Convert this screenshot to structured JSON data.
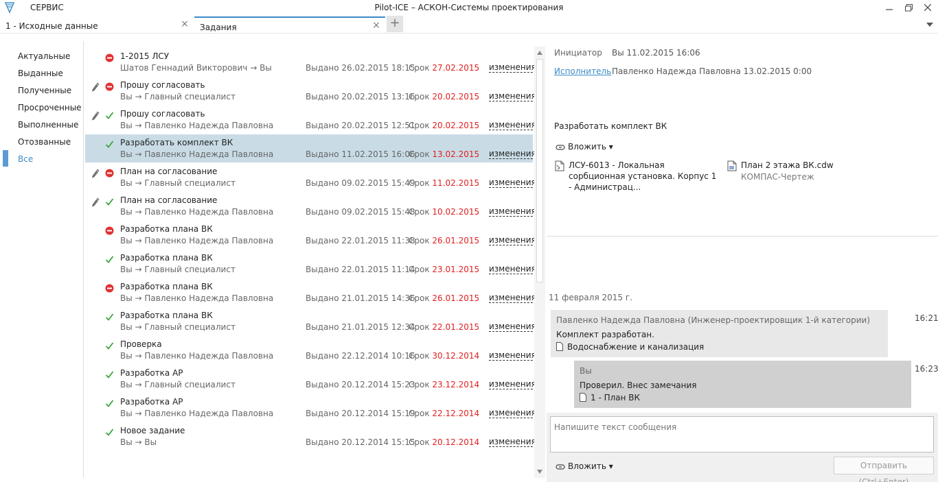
{
  "window": {
    "title": "Pilot-ICE – АСКОН-Системы проектирования",
    "menu_service": "СЕРВИС"
  },
  "tabs": [
    {
      "label": "1 - Исходные данные"
    },
    {
      "label": "Задания"
    }
  ],
  "nav": {
    "items": [
      "Актуальные",
      "Выданные",
      "Полученные",
      "Просроченные",
      "Выполненные",
      "Отозванные",
      "Все"
    ],
    "active_index": 6
  },
  "due_prefix": "Срок",
  "changes_label": "изменения",
  "tasks": [
    {
      "title": "1-2015 ЛСУ",
      "route": "Шатов Геннадий Викторович → Вы",
      "issued": "Выдано 26.02.2015 18:15",
      "due": "27.02.2015",
      "status": "blocked",
      "pen": false,
      "selected": false
    },
    {
      "title": "Прошу согласовать",
      "route": "Вы → Главный специалист",
      "issued": "Выдано 20.02.2015 13:16",
      "due": "20.02.2015",
      "status": "blocked",
      "pen": true,
      "selected": false
    },
    {
      "title": "Прошу согласовать",
      "route": "Вы → Павленко Надежда Павловна",
      "issued": "Выдано 20.02.2015 12:51",
      "due": "20.02.2015",
      "status": "done",
      "pen": true,
      "selected": false
    },
    {
      "title": "Разработать комплект ВК",
      "route": "Вы → Павленко Надежда Павловна",
      "issued": "Выдано 11.02.2015 16:06",
      "due": "13.02.2015",
      "status": "done",
      "pen": false,
      "selected": true
    },
    {
      "title": "План на согласование",
      "route": "Вы → Главный специалист",
      "issued": "Выдано 09.02.2015 15:49",
      "due": "11.02.2015",
      "status": "blocked",
      "pen": true,
      "selected": false
    },
    {
      "title": "План на согласование",
      "route": "Вы → Павленко Надежда Павловна",
      "issued": "Выдано 09.02.2015 15:48",
      "due": "10.02.2015",
      "status": "done",
      "pen": true,
      "selected": false
    },
    {
      "title": "Разработка плана ВК",
      "route": "Вы → Павленко Надежда Павловна",
      "issued": "Выдано 22.01.2015 11:38",
      "due": "26.01.2015",
      "status": "blocked",
      "pen": false,
      "selected": false
    },
    {
      "title": "Разработка плана ВК",
      "route": "Вы → Главный специалист",
      "issued": "Выдано 22.01.2015 11:14",
      "due": "23.01.2015",
      "status": "done",
      "pen": false,
      "selected": false
    },
    {
      "title": "Разработка плана ВК",
      "route": "Вы → Павленко Надежда Павловна",
      "issued": "Выдано 21.01.2015 14:36",
      "due": "26.01.2015",
      "status": "blocked",
      "pen": false,
      "selected": false
    },
    {
      "title": "Разработка плана ВК",
      "route": "Вы → Главный специалист",
      "issued": "Выдано 21.01.2015 12:34",
      "due": "22.01.2015",
      "status": "done",
      "pen": false,
      "selected": false
    },
    {
      "title": "Проверка",
      "route": "Вы → Павленко Надежда Павловна",
      "issued": "Выдано 22.12.2014 10:16",
      "due": "30.12.2014",
      "status": "done",
      "pen": false,
      "selected": false
    },
    {
      "title": "Разработка АР",
      "route": "Вы → Главный специалист",
      "issued": "Выдано 20.12.2014 15:23",
      "due": "23.12.2014",
      "status": "done",
      "pen": false,
      "selected": false
    },
    {
      "title": "Разработка АР",
      "route": "Вы → Павленко Надежда Павловна",
      "issued": "Выдано 20.12.2014 15:19",
      "due": "22.12.2014",
      "status": "done",
      "pen": false,
      "selected": false
    },
    {
      "title": "Новое задание",
      "route": "Вы → Вы",
      "issued": "Выдано 20.12.2014 15:15",
      "due": "20.12.2014",
      "status": "done",
      "pen": false,
      "selected": false
    }
  ],
  "detail": {
    "initiator_label": "Инициатор",
    "initiator_value": "Вы 11.02.2015 16:06",
    "executor_label": "Исполнитель",
    "executor_value": "Павленко Надежда Павловна 13.02.2015 0:00",
    "description": "Разработать комплект ВК",
    "attach_label": "Вложить ▾",
    "files": [
      {
        "name": "ЛСУ-6013 - Локальная сорбционная установка. Корпус 1 - Администрац...",
        "sub": ""
      },
      {
        "name": "План 2 этажа ВК.cdw",
        "sub": "КОМПАС-Чертеж"
      }
    ]
  },
  "messages": {
    "date": "11 февраля 2015 г.",
    "items": [
      {
        "author": "Павленко Надежда Павловна (Инженер-проектировщик 1-й категории)",
        "text": "Комплект разработан.",
        "attachment": "Водоснабжение и канализация",
        "time": "16:21"
      },
      {
        "author": "Вы",
        "text": "Проверил. Внес замечания",
        "attachment": "1 - План ВК",
        "time": "16:23"
      }
    ]
  },
  "compose": {
    "placeholder": "Напишите текст сообщения",
    "attach_label": "Вложить ▾",
    "send_label": "Отправить (Ctrl+Enter)"
  },
  "colors": {
    "accent": "#3c8bc7",
    "selected_row": "#c9dce6",
    "due_date": "#e02020",
    "status_done": "#3aa53a",
    "status_blocked": "#e03232"
  },
  "icons": {
    "logo": "pilot-logo-icon",
    "pen": "pen-icon",
    "done": "checkmark-icon",
    "blocked": "no-entry-icon",
    "attach": "paperclip-icon",
    "document": "document-icon"
  }
}
